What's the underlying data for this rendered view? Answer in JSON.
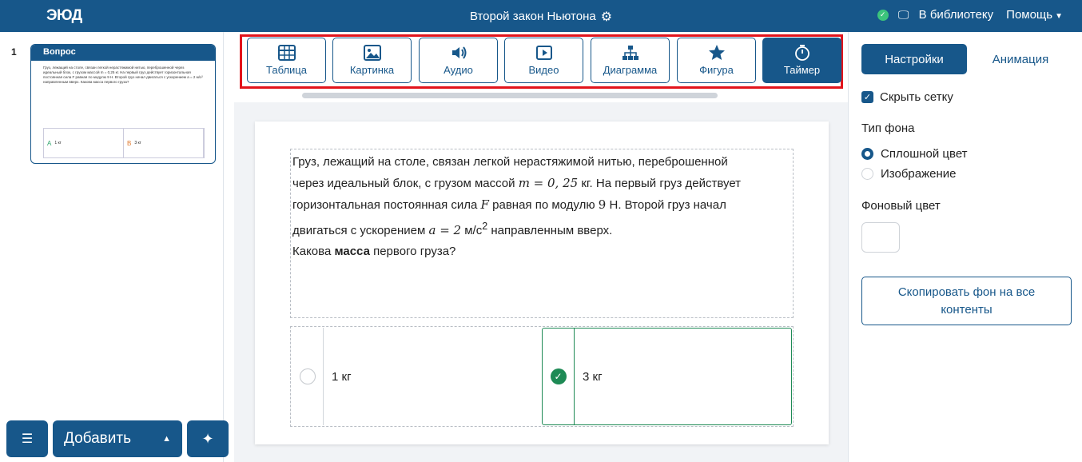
{
  "header": {
    "logo": "ЭЮД",
    "doc_title": "Второй закон Ньютона",
    "library_label": "В библиотеку",
    "help_label": "Помощь",
    "colors": {
      "primary": "#17578a",
      "status": "#3cc47c"
    }
  },
  "slides": {
    "items": [
      {
        "number": "1",
        "title": "Вопрос",
        "preview_text": "Груз, лежащий на столе, связан легкой нерастяжимой нитью, переброшенной через идеальный блок, с грузом массой m = 0,25 кг. На первый груз действует горизонтальная постоянная сила F равная по модулю 9 Н. Второй груз начал двигаться с ускорением a = 2 м/с² направленным вверх. Какова масса первого груза?",
        "answers": [
          {
            "label": "A",
            "text": "1 кг"
          },
          {
            "label": "B",
            "text": "3 кг"
          }
        ]
      }
    ],
    "add_label": "Добавить"
  },
  "toolbar": {
    "items": [
      {
        "label": "Таблица",
        "icon": "table-icon"
      },
      {
        "label": "Картинка",
        "icon": "image-icon"
      },
      {
        "label": "Аудио",
        "icon": "audio-icon"
      },
      {
        "label": "Видео",
        "icon": "video-icon"
      },
      {
        "label": "Диаграмма",
        "icon": "diagram-icon"
      },
      {
        "label": "Фигура",
        "icon": "star-icon"
      },
      {
        "label": "Таймер",
        "icon": "timer-icon",
        "active": true
      }
    ]
  },
  "question": {
    "line1": "Груз, лежащий на столе, связан легкой нерастяжимой нитью, переброшенной",
    "line2_a": "через идеальный блок, с грузом массой ",
    "line2_math": "m = 0, 25",
    "line2_b": " кг. На первый груз действует",
    "line3_a": "горизонтальная постоянная сила ",
    "line3_math": "F",
    "line3_b": " равная по модулю ",
    "line3_math2": "9",
    "line3_c": " Н. Второй груз начал",
    "line4_a": "двигаться с ускорением ",
    "line4_math": "a = 2",
    "line4_b": " м/с",
    "line4_sup": "2",
    "line4_c": " направленным вверх.",
    "line5_a": "Какова ",
    "line5_bold": "масса",
    "line5_b": " первого груза?"
  },
  "answers": [
    {
      "text": "1 кг",
      "correct": false
    },
    {
      "text": "3 кг",
      "correct": true
    }
  ],
  "settings": {
    "tab_settings": "Настройки",
    "tab_animation": "Анимация",
    "hide_grid_label": "Скрыть сетку",
    "bg_type_label": "Тип фона",
    "bg_solid_label": "Сплошной цвет",
    "bg_image_label": "Изображение",
    "bg_color_label": "Фоновый цвет",
    "copy_bg_label": "Скопировать фон на все контенты"
  }
}
